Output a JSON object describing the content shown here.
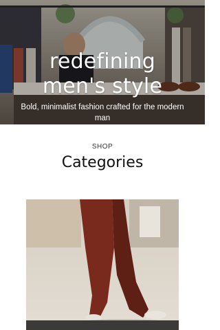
{
  "hero": {
    "title": "redefining\nmen's style",
    "subtitle": "Bold, minimalist fashion crafted for the modern man"
  },
  "section": {
    "kicker": "SHOP",
    "title": "Categories"
  }
}
